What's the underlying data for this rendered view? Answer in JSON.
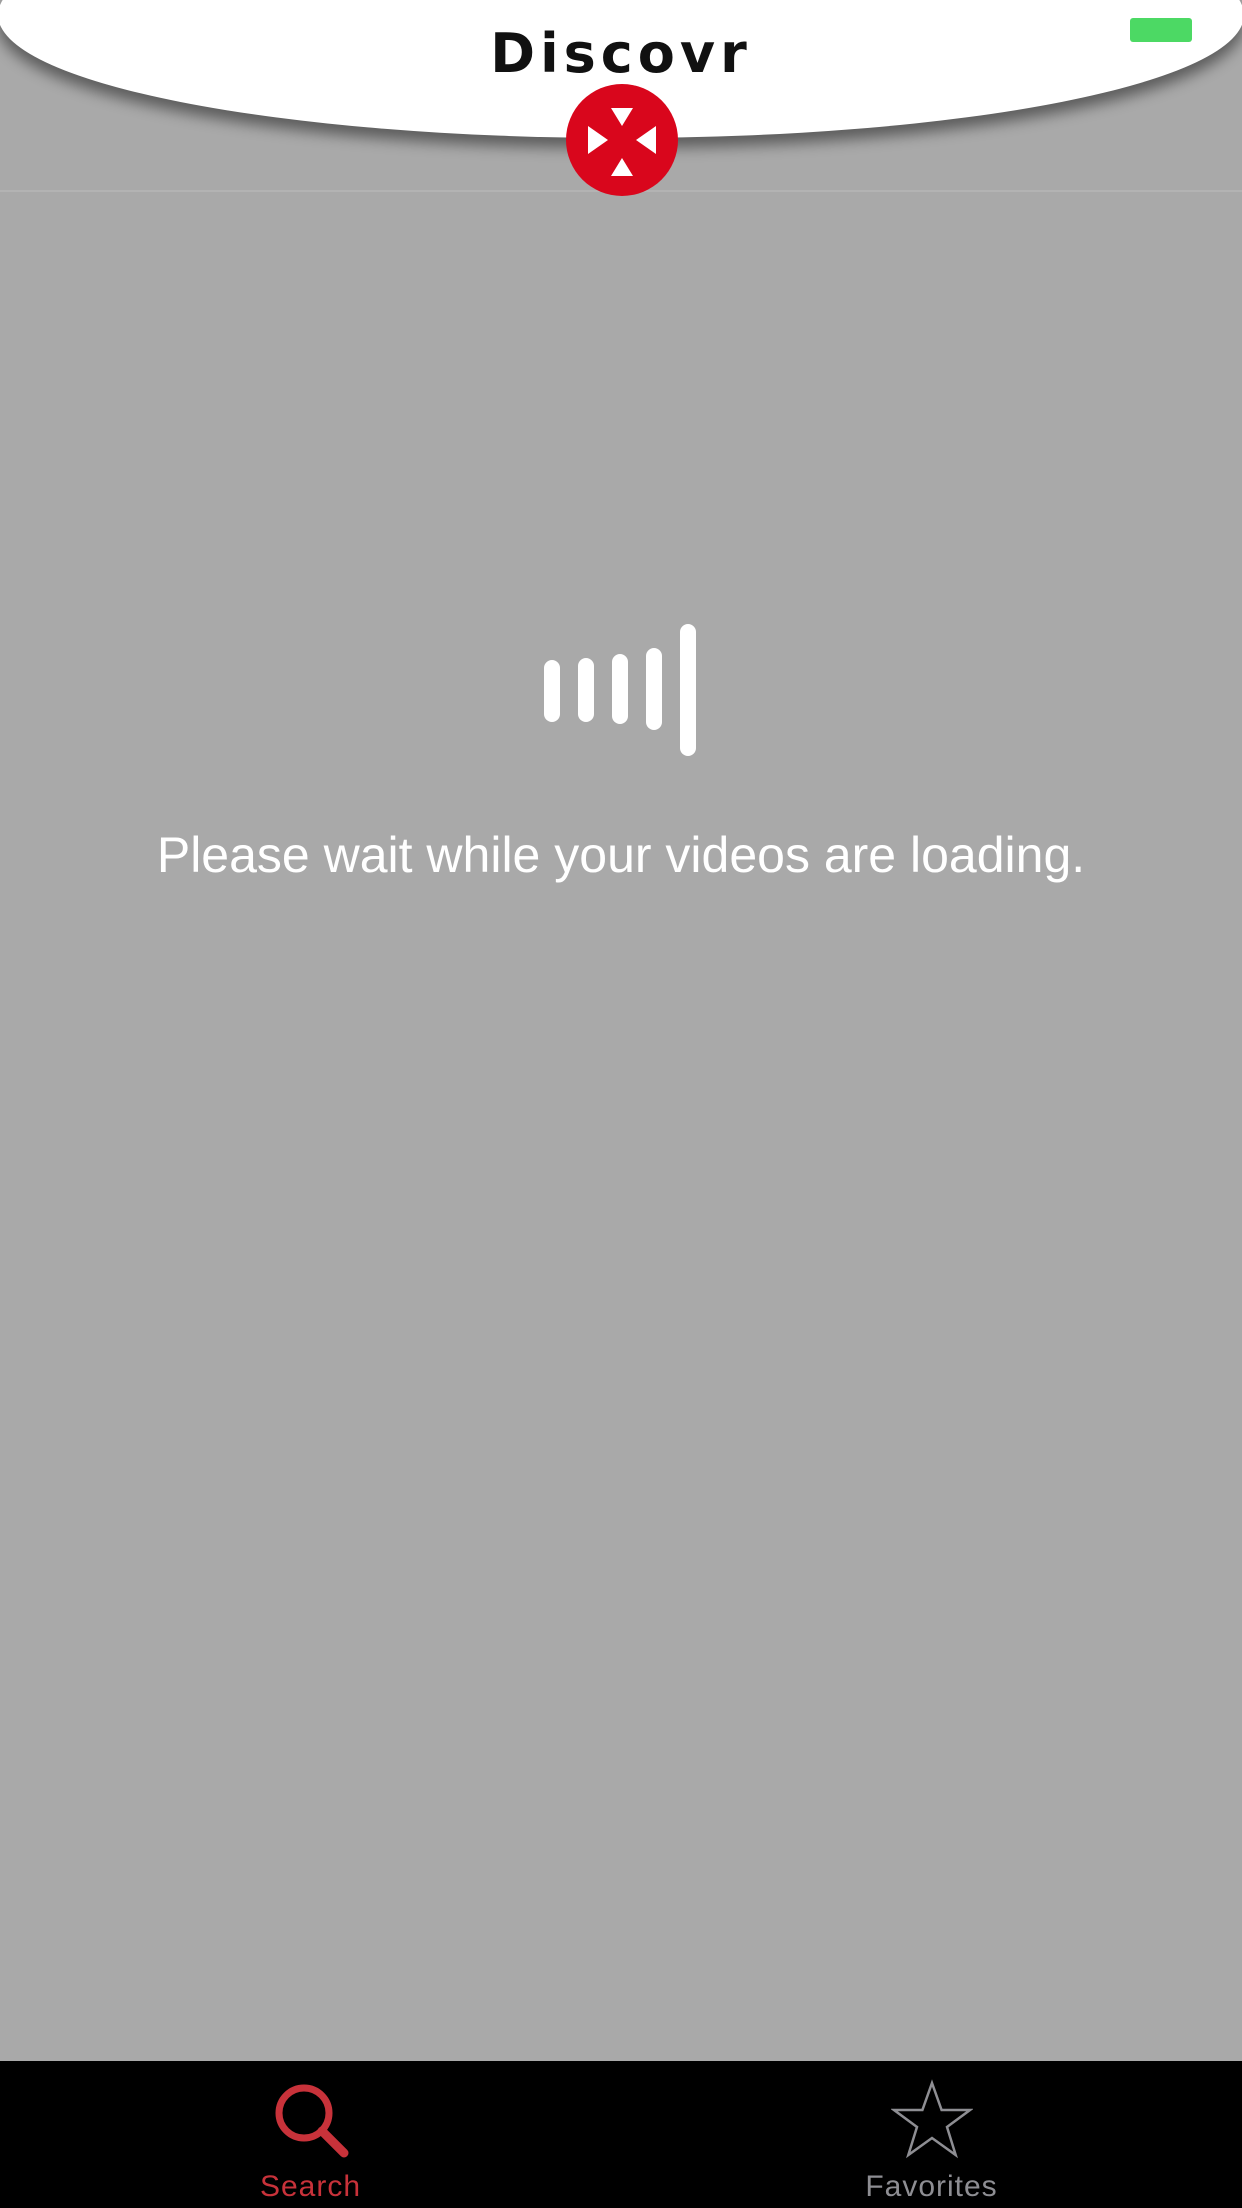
{
  "header": {
    "title": "Discovr",
    "logo_icon": "discovr-logo-icon",
    "logo_color": "#d9061c",
    "battery_icon": "battery-icon",
    "battery_color": "#4cd964"
  },
  "main": {
    "background_color": "#a9a9a9",
    "loader_icon": "loading-bars-icon",
    "loading_message": "Please wait while your videos are loading."
  },
  "tabbar": {
    "tabs": [
      {
        "label": "Search",
        "icon": "search-icon",
        "color": "#c8323a",
        "selected": true
      },
      {
        "label": "Favorites",
        "icon": "star-icon",
        "color": "#8e8e93",
        "selected": false
      }
    ]
  }
}
